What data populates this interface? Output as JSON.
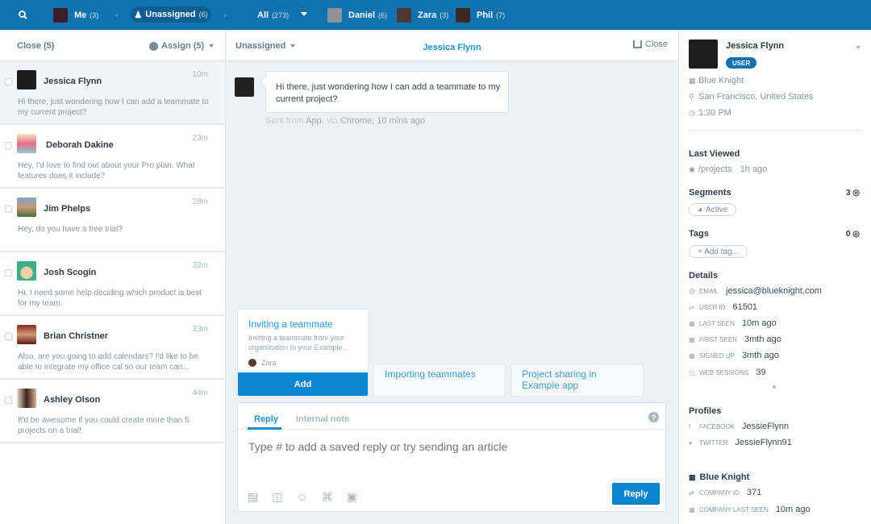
{
  "topbar": {
    "search_icon": "search-icon",
    "items": [
      {
        "label": "Me",
        "count": "(3)"
      },
      {
        "label": "Unassigned",
        "count": "(6)"
      },
      {
        "label": "All",
        "count": "(273)"
      },
      {
        "label": "Daniel",
        "count": "(6)"
      },
      {
        "label": "Zara",
        "count": "(3)"
      },
      {
        "label": "Phil",
        "count": "(7)"
      }
    ],
    "colors": {
      "bar": "#1272b0",
      "active_pill": "#0f5e93"
    }
  },
  "inbox": {
    "close_label": "Close (5)",
    "assign_label": "Assign (5)",
    "conversations": [
      {
        "name": "Jessica Flynn",
        "time": "10m",
        "message": "Hi there, just wondering how I can add a teammate to my current project?",
        "selected": true
      },
      {
        "name": "Deborah Dakine",
        "time": "23m",
        "message": "Hey, I'd love to find out about your Pro plan. What features does it include?"
      },
      {
        "name": "Jim Phelps",
        "time": "28m",
        "message": "Hey, do you have a free trial?"
      },
      {
        "name": "Josh Scogin",
        "time": "32m",
        "message": "Hi, I need some help deciding which product is best for my team."
      },
      {
        "name": "Brian Christner",
        "time": "33m",
        "message": "Also, are you going to add calendars? I'd like to be able to integrate my office cal so our team can..."
      },
      {
        "name": "Ashley Olson",
        "time": "44m",
        "message": "It'd be awesome if you could create more than 5 projects on a trial!"
      }
    ]
  },
  "conversation": {
    "assignee": "Unassigned",
    "title": "Jessica Flynn",
    "close_label": "Close",
    "message": "Hi there, just wondering how I can add a teammate to my current project?",
    "meta": {
      "sent_from": "Sent from",
      "app": "App",
      "via": ", via",
      "browser": "Chrome",
      "ago": ", 10 mins ago"
    },
    "suggestions": [
      {
        "title": "Inviting a teammate",
        "description": "Inviting a teammate from your organization to your Example...",
        "author": "Zara",
        "action": "Add"
      },
      {
        "title": "Importing teammates"
      },
      {
        "title": "Project sharing in Example app"
      }
    ],
    "composer": {
      "tabs": [
        "Reply",
        "Internal note"
      ],
      "active_tab": "Reply",
      "placeholder": "Type # to add a saved reply or try sending an article",
      "help": "?",
      "reply_button": "Reply"
    }
  },
  "profile": {
    "name": "Jessica Flynn",
    "badge": "USER",
    "company": "Blue Knight",
    "location": "San Francisco, United States",
    "local_time": "1:30 PM",
    "last_viewed": {
      "heading": "Last Viewed",
      "page": "/projects",
      "ago": "1h ago"
    },
    "segments": {
      "heading": "Segments",
      "count": "3",
      "items": [
        "Active"
      ]
    },
    "tags": {
      "heading": "Tags",
      "count": "0",
      "add_label": "+ Add tag..."
    },
    "details": {
      "heading": "Details",
      "rows": [
        {
          "label": "EMAIL",
          "value": "jessica@blueknight.com",
          "icon": "@"
        },
        {
          "label": "USER ID",
          "value": "61501",
          "icon": "⇄"
        },
        {
          "label": "LAST SEEN",
          "value": "10m ago",
          "icon": "▦"
        },
        {
          "label": "FIRST SEEN",
          "value": "3mth ago",
          "icon": "▦"
        },
        {
          "label": "SIGNED UP",
          "value": "3mth ago",
          "icon": "▦"
        },
        {
          "label": "WEB SESSIONS",
          "value": "39",
          "icon": "◳"
        }
      ],
      "more": "»"
    },
    "profiles": {
      "heading": "Profiles",
      "rows": [
        {
          "label": "FACEBOOK",
          "value": "JessieFlynn",
          "icon": "f"
        },
        {
          "label": "TWITTER",
          "value": "JessieFlynn91",
          "icon": "♦"
        }
      ]
    },
    "company_section": {
      "name": "Blue Knight",
      "rows": [
        {
          "label": "COMPANY ID",
          "value": "371",
          "icon": "⇄"
        },
        {
          "label": "COMPANY LAST SEEN",
          "value": "10m ago",
          "icon": "▦"
        }
      ]
    }
  }
}
